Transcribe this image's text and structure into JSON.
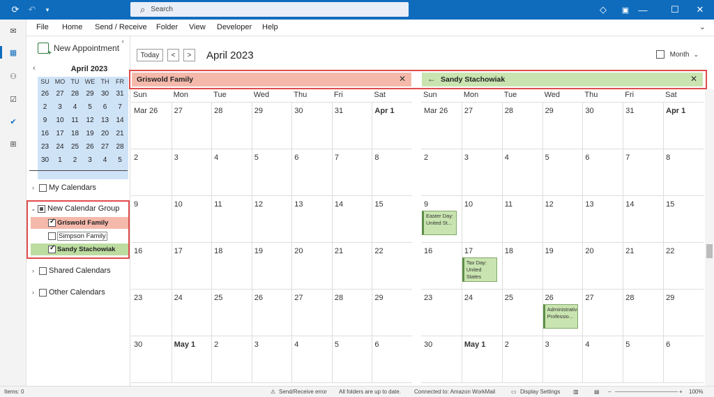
{
  "titlebar": {
    "search_placeholder": "Search"
  },
  "menu": [
    "File",
    "Home",
    "Send / Receive",
    "Folder",
    "View",
    "Developer",
    "Help"
  ],
  "folder_pane": {
    "new_appointment": "New Appointment",
    "mini_calendar": {
      "title": "April 2023",
      "day_headers": [
        "SU",
        "MO",
        "TU",
        "WE",
        "TH",
        "FR"
      ],
      "weeks": [
        [
          "26",
          "27",
          "28",
          "29",
          "30",
          "31"
        ],
        [
          "2",
          "3",
          "4",
          "5",
          "6",
          "7"
        ],
        [
          "9",
          "10",
          "11",
          "12",
          "13",
          "14"
        ],
        [
          "16",
          "17",
          "18",
          "19",
          "20",
          "21"
        ],
        [
          "23",
          "24",
          "25",
          "26",
          "27",
          "28"
        ],
        [
          "30",
          "1",
          "2",
          "3",
          "4",
          "5"
        ]
      ]
    },
    "tree": {
      "my_calendars": "My Calendars",
      "new_group": "New Calendar Group",
      "griswold": "Griswold Family",
      "simpson": "Simpson Family",
      "sandy": "Sandy Stachowiak",
      "shared": "Shared Calendars",
      "other": "Other Calendars"
    }
  },
  "header": {
    "today_button": "Today",
    "prev": "<",
    "next": ">",
    "month_title": "April 2023",
    "view_label": "Month"
  },
  "tabs": {
    "left": "Griswold Family",
    "right": "Sandy Stachowiak"
  },
  "calendar": {
    "day_names": [
      "Sun",
      "Mon",
      "Tue",
      "Wed",
      "Thu",
      "Fri",
      "Sat"
    ],
    "weeks": [
      [
        "Mar 26",
        "27",
        "28",
        "29",
        "30",
        "31",
        "Apr 1"
      ],
      [
        "2",
        "3",
        "4",
        "5",
        "6",
        "7",
        "8"
      ],
      [
        "9",
        "10",
        "11",
        "12",
        "13",
        "14",
        "15"
      ],
      [
        "16",
        "17",
        "18",
        "19",
        "20",
        "21",
        "22"
      ],
      [
        "23",
        "24",
        "25",
        "26",
        "27",
        "28",
        "29"
      ],
      [
        "30",
        "May 1",
        "2",
        "3",
        "4",
        "5",
        "6"
      ]
    ],
    "events": [
      {
        "week": 2,
        "day": 0,
        "text": "Easter Day: United St..."
      },
      {
        "week": 3,
        "day": 1,
        "text": "Tax Day: United States"
      },
      {
        "week": 4,
        "day": 3,
        "text": "Administrative Professio..."
      }
    ]
  },
  "status": {
    "items": "Items: 0",
    "send_receive": "Send/Receive error",
    "folders": "All folders are up to date.",
    "connected": "Connected to: Amazon WorkMail",
    "display": "Display Settings",
    "zoom": "100%"
  },
  "colors": {
    "accent": "#0f6cbd",
    "griswold": "#f4b9ab",
    "sandy": "#c9e4b0",
    "highlight_box": "#e04b4b"
  }
}
